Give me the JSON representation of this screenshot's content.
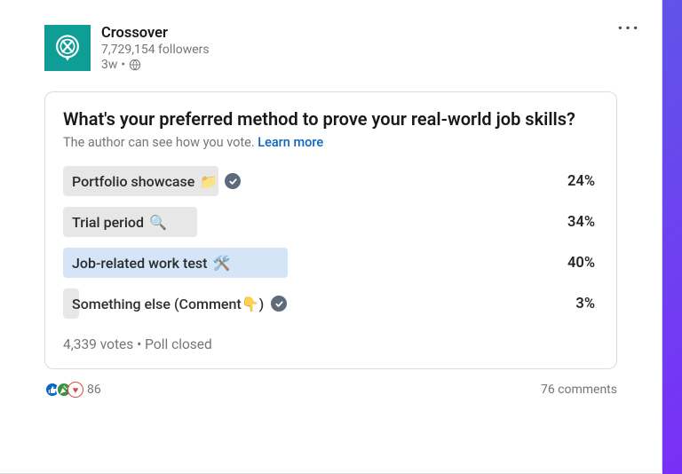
{
  "header": {
    "company_name": "Crossover",
    "followers_text": "7,729,154 followers",
    "time_text": "3w"
  },
  "more_label": "···",
  "poll": {
    "question": "What's your preferred method to prove your real-world job skills?",
    "subline_text": "The author can see how you vote. ",
    "learn_more": "Learn more",
    "options": [
      {
        "label": "Portfolio showcase",
        "emoji": "📁",
        "pct": "24%",
        "bar_width": "29%",
        "selected": false
      },
      {
        "label": "Trial period",
        "emoji": "🔍",
        "pct": "34%",
        "bar_width": "25%",
        "selected": false
      },
      {
        "label": "Job-related work test",
        "emoji": "🛠️",
        "pct": "40%",
        "bar_width": "42%",
        "selected": true
      },
      {
        "label": "Something else (Comment👇)",
        "emoji": "",
        "pct": "3%",
        "bar_width": "3%",
        "selected": false
      }
    ],
    "meta": "4,339 votes • Poll closed"
  },
  "footer": {
    "reaction_count": "86",
    "comments_text": "76 comments"
  }
}
